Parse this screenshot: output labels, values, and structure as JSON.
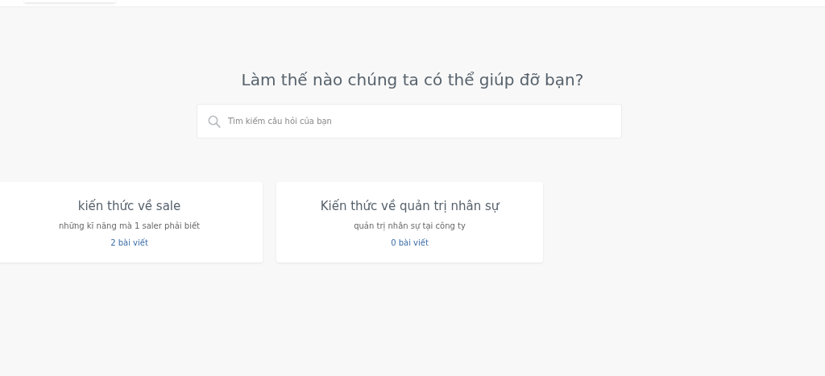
{
  "heading": "Làm thế nào chúng ta có thể giúp đỡ bạn?",
  "search": {
    "placeholder": "Tìm kiếm câu hỏi của bạn"
  },
  "categories": [
    {
      "title": "kiến thức về sale",
      "description": "những kĩ năng mà 1 saler phải biết",
      "count": "2 bài viết"
    },
    {
      "title": "Kiến thức về quản trị nhân sự",
      "description": "quản trị nhân sự tại công ty",
      "count": "0 bài viết"
    }
  ]
}
